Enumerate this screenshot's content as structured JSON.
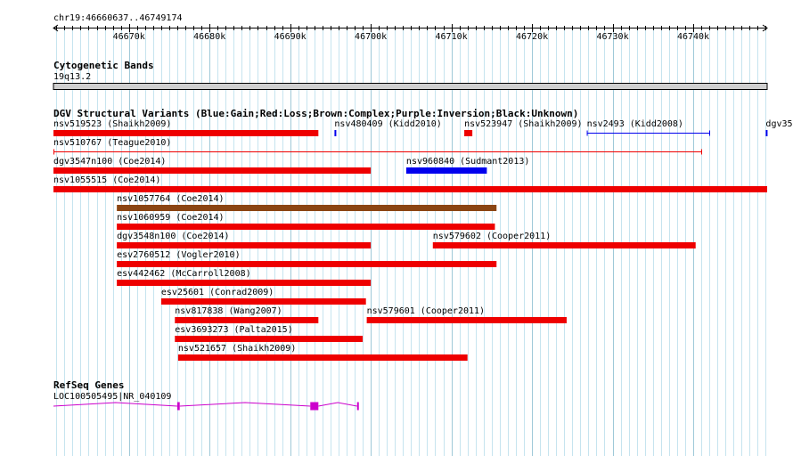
{
  "coordinate": "chr19:46660637..46749174",
  "ruler": {
    "start": 46660637,
    "end": 46749174,
    "ticks": [
      {
        "pos": 46670000,
        "label": "46670k"
      },
      {
        "pos": 46680000,
        "label": "46680k"
      },
      {
        "pos": 46690000,
        "label": "46690k"
      },
      {
        "pos": 46700000,
        "label": "46700k"
      },
      {
        "pos": 46710000,
        "label": "46710k"
      },
      {
        "pos": 46720000,
        "label": "46720k"
      },
      {
        "pos": 46730000,
        "label": "46730k"
      },
      {
        "pos": 46740000,
        "label": "46740k"
      }
    ]
  },
  "tracks": {
    "cytoband": {
      "title": "Cytogenetic Bands",
      "band": "19q13.2"
    },
    "dgv": {
      "title": "DGV Structural Variants (Blue:Gain;Red:Loss;Brown:Complex;Purple:Inversion;Black:Unknown)",
      "features": [
        {
          "row": 0,
          "label": "nsv519523 (Shaikh2009)",
          "start": 46660637,
          "end": 46693500,
          "type": "loss",
          "style": "thick"
        },
        {
          "row": 0,
          "label": "nsv480409 (Kidd2010)",
          "start": 46695500,
          "end": 46695700,
          "type": "gain",
          "style": "thick"
        },
        {
          "row": 0,
          "label": "nsv523947 (Shaikh2009)",
          "start": 46711600,
          "end": 46712600,
          "type": "loss",
          "style": "thick"
        },
        {
          "row": 0,
          "label": "nsv2493 (Kidd2008)",
          "start": 46726800,
          "end": 46742100,
          "type": "gain",
          "style": "thin"
        },
        {
          "row": 0,
          "label": "dgv35",
          "start": 46749000,
          "end": 46749174,
          "type": "gain",
          "style": "thick"
        },
        {
          "row": 1,
          "label": "nsv510767 (Teague2010)",
          "start": 46660637,
          "end": 46741100,
          "type": "loss",
          "style": "thin"
        },
        {
          "row": 2,
          "label": "dgv3547n100 (Coe2014)",
          "start": 46660637,
          "end": 46700000,
          "type": "loss",
          "style": "thick"
        },
        {
          "row": 2,
          "label": "nsv960840 (Sudmant2013)",
          "start": 46704400,
          "end": 46714400,
          "type": "gain",
          "style": "thick"
        },
        {
          "row": 3,
          "label": "nsv1055515 (Coe2014)",
          "start": 46660637,
          "end": 46749174,
          "type": "loss",
          "style": "thick"
        },
        {
          "row": 4,
          "label": "nsv1057764 (Coe2014)",
          "start": 46668500,
          "end": 46715600,
          "type": "complex",
          "style": "thick"
        },
        {
          "row": 5,
          "label": "nsv1060959 (Coe2014)",
          "start": 46668500,
          "end": 46715400,
          "type": "loss",
          "style": "thick"
        },
        {
          "row": 6,
          "label": "dgv3548n100 (Coe2014)",
          "start": 46668500,
          "end": 46700000,
          "type": "loss",
          "style": "thick"
        },
        {
          "row": 6,
          "label": "nsv579602 (Cooper2011)",
          "start": 46707700,
          "end": 46740300,
          "type": "loss",
          "style": "thick"
        },
        {
          "row": 7,
          "label": "esv2760512 (Vogler2010)",
          "start": 46668500,
          "end": 46715600,
          "type": "loss",
          "style": "thick"
        },
        {
          "row": 8,
          "label": "esv442462 (McCarroll2008)",
          "start": 46668500,
          "end": 46700000,
          "type": "loss",
          "style": "thick"
        },
        {
          "row": 9,
          "label": "esv25601 (Conrad2009)",
          "start": 46674000,
          "end": 46699400,
          "type": "loss",
          "style": "thick"
        },
        {
          "row": 10,
          "label": "nsv817838 (Wang2007)",
          "start": 46675700,
          "end": 46693500,
          "type": "loss",
          "style": "thick"
        },
        {
          "row": 10,
          "label": "nsv579601 (Cooper2011)",
          "start": 46699500,
          "end": 46724300,
          "type": "loss",
          "style": "thick"
        },
        {
          "row": 11,
          "label": "esv3693273 (Palta2015)",
          "start": 46675700,
          "end": 46699000,
          "type": "loss",
          "style": "thick"
        },
        {
          "row": 12,
          "label": "nsv521657 (Shaikh2009)",
          "start": 46676100,
          "end": 46712000,
          "type": "loss",
          "style": "thick"
        }
      ]
    },
    "refseq": {
      "title": "RefSeq Genes",
      "gene_label": "LOC100505495|NR_040109",
      "start": 46660637,
      "end": 46698500,
      "exons": [
        {
          "start": 46676000,
          "end": 46676300
        },
        {
          "start": 46692500,
          "end": 46693500
        },
        {
          "start": 46698300,
          "end": 46698500
        }
      ]
    }
  },
  "colors": {
    "gain": "#0000ee",
    "loss": "#ee0000",
    "complex": "#8b4513",
    "inversion": "#800080",
    "unknown": "#000000",
    "grid_minor": "#c6e4ef",
    "grid_major": "#9fc9d8",
    "gene": "#cc00cc",
    "cytoband_fill": "#cfcfcf"
  }
}
